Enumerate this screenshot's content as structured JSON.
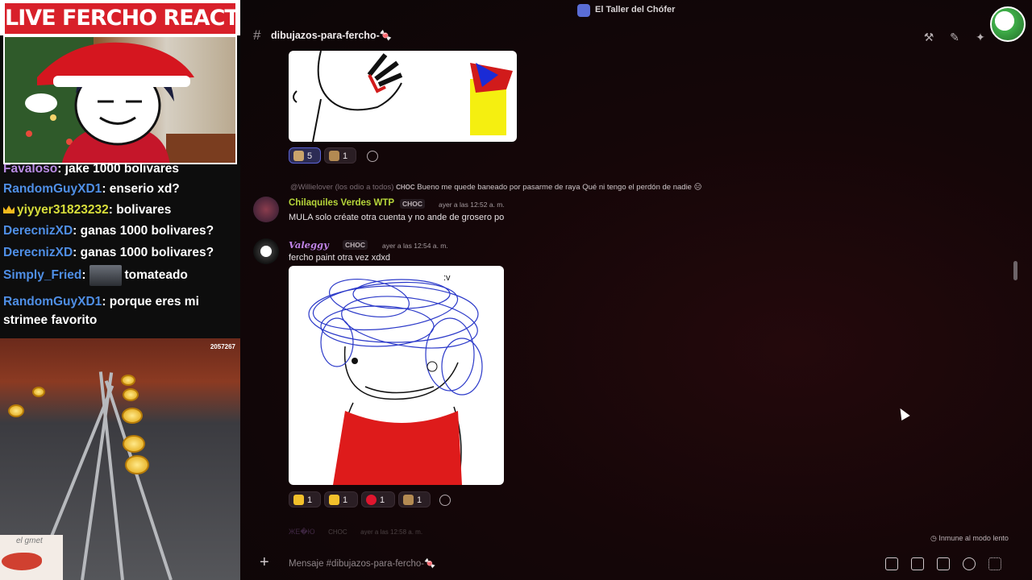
{
  "stream": {
    "banner": "LIVE FERCHO REACTION",
    "chat": [
      {
        "user": "Favaloso",
        "text": ": jake 1000 bolivares",
        "color": "purple"
      },
      {
        "user": "RandomGuyXD1",
        "text": ": enserio xd?",
        "color": "blue"
      },
      {
        "user": "yiyyer31823232",
        "text": ": bolivares",
        "color": "gold"
      },
      {
        "user": "DerecnizXD",
        "text": ": ganas 1000 bolivares?",
        "color": "blue"
      },
      {
        "user": "DerecnizXD",
        "text": ": ganas 1000 bolivares?",
        "color": "blue"
      },
      {
        "user": "Simply_Fried",
        "text": "tomateado",
        "color": "blue"
      },
      {
        "user": "RandomGuyXD1",
        "text": ": porque eres mi",
        "text2": "strimee favorito",
        "color": "blue"
      }
    ],
    "game_score": "2057267",
    "handcam_text": "el gmet"
  },
  "discord": {
    "server_name": "El Taller del Chófer",
    "channel_name": "dibujazos-para-fercho-🍬",
    "message1_reactions": [
      {
        "count": "5",
        "active": true,
        "emoji": "emoji-reaction"
      },
      {
        "count": "1",
        "active": false,
        "emoji": "emoji-reaction"
      }
    ],
    "message2": {
      "reply_user": "@Willielover (los odio a todos)",
      "reply_tag": "CHOC",
      "reply_text": "Bueno me quede baneado por pasarme de raya Qué ni tengo el perdón de nadie 😑",
      "author": "Chilaquiles Verdes WTP",
      "tag": "CHOC",
      "time": "ayer a las 12:52 a. m.",
      "text": "MULA solo créate otra cuenta y no ande de grosero po"
    },
    "message3": {
      "author": "Valeggy",
      "tag": "CHOC",
      "time": "ayer a las 12:54 a. m.",
      "text": "fercho paint otra vez xdxd",
      "reactions": [
        {
          "count": "1",
          "active": false,
          "emoji": "thumbs-up"
        },
        {
          "count": "1",
          "active": false,
          "emoji": "clap"
        },
        {
          "count": "1",
          "active": false,
          "emoji": "heart"
        },
        {
          "count": "1",
          "active": false,
          "emoji": "emoji-reaction"
        }
      ]
    },
    "partial_message": {
      "author": "ЖЕ�Ю",
      "tag": "CHOC",
      "time": "ayer a las 12:58 a. m."
    },
    "slowmode_label": "Inmune al modo lento",
    "composer_placeholder": "Mensaje #dibujazos-para-fercho-🍬",
    "colors": {
      "accent": "#5b63d6",
      "author_green": "#b6d63a",
      "author_purple": "#c084e8"
    }
  }
}
